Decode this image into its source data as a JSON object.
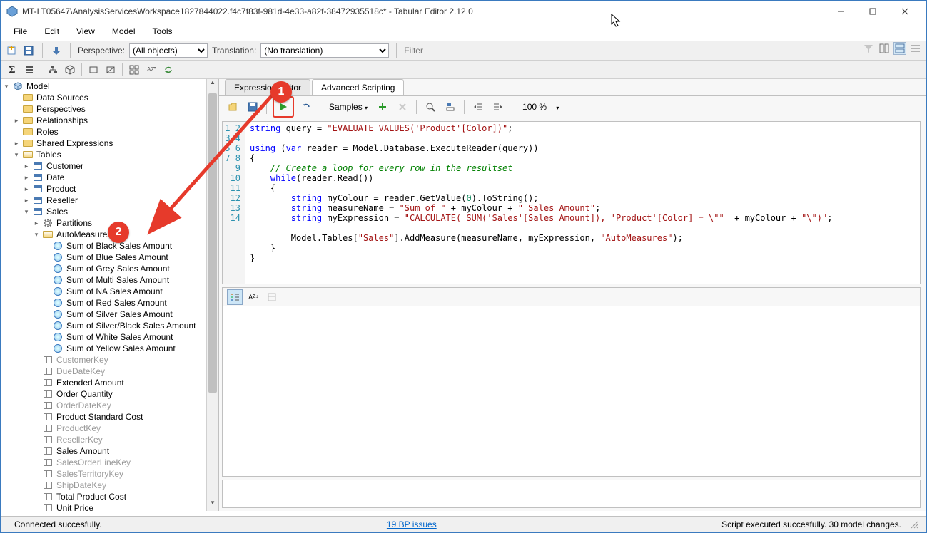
{
  "window": {
    "title": "MT-LT05647\\AnalysisServicesWorkspace1827844022.f4c7f83f-981d-4e33-a82f-38472935518c* - Tabular Editor 2.12.0"
  },
  "menus": [
    "File",
    "Edit",
    "View",
    "Model",
    "Tools"
  ],
  "toolbar": {
    "perspective_label": "Perspective:",
    "perspective_value": "(All objects)",
    "translation_label": "Translation:",
    "translation_value": "(No translation)",
    "filter_placeholder": "Filter"
  },
  "tree": {
    "root": "Model",
    "children": [
      {
        "label": "Data Sources",
        "icon": "folder"
      },
      {
        "label": "Perspectives",
        "icon": "folder"
      },
      {
        "label": "Relationships",
        "icon": "folder",
        "tw": "▸"
      },
      {
        "label": "Roles",
        "icon": "folder"
      },
      {
        "label": "Shared Expressions",
        "icon": "folder",
        "tw": "▸"
      },
      {
        "label": "Tables",
        "icon": "folder-open",
        "tw": "▾"
      }
    ],
    "tables": [
      {
        "label": "Customer",
        "tw": "▸"
      },
      {
        "label": "Date",
        "tw": "▸"
      },
      {
        "label": "Product",
        "tw": "▸"
      },
      {
        "label": "Reseller",
        "tw": "▸"
      },
      {
        "label": "Sales",
        "tw": "▾"
      }
    ],
    "sales_children": [
      {
        "label": "Partitions",
        "icon": "gear",
        "tw": "▸"
      },
      {
        "label": "AutoMeasures",
        "icon": "folder-open",
        "tw": "▾"
      }
    ],
    "auto_measures": [
      "Sum of Black Sales Amount",
      "Sum of Blue Sales Amount",
      "Sum of Grey Sales Amount",
      "Sum of Multi Sales Amount",
      "Sum of NA Sales Amount",
      "Sum of Red Sales Amount",
      "Sum of Silver Sales Amount",
      "Sum of Silver/Black Sales Amount",
      "Sum of White Sales Amount",
      "Sum of Yellow Sales Amount"
    ],
    "columns": [
      {
        "label": "CustomerKey",
        "dim": true
      },
      {
        "label": "DueDateKey",
        "dim": true
      },
      {
        "label": "Extended Amount",
        "dim": false
      },
      {
        "label": "Order Quantity",
        "dim": false
      },
      {
        "label": "OrderDateKey",
        "dim": true
      },
      {
        "label": "Product Standard Cost",
        "dim": false
      },
      {
        "label": "ProductKey",
        "dim": true
      },
      {
        "label": "ResellerKey",
        "dim": true
      },
      {
        "label": "Sales Amount",
        "dim": false
      },
      {
        "label": "SalesOrderLineKey",
        "dim": true
      },
      {
        "label": "SalesTerritoryKey",
        "dim": true
      },
      {
        "label": "ShipDateKey",
        "dim": true
      },
      {
        "label": "Total Product Cost",
        "dim": false
      },
      {
        "label": "Unit Price",
        "dim": false
      }
    ]
  },
  "tabs": {
    "t1": "Expression Editor",
    "t2": "Advanced Scripting"
  },
  "editor_toolbar": {
    "samples": "Samples",
    "zoom": "100 %"
  },
  "code_lines": 14,
  "status": {
    "left": "Connected succesfully.",
    "bp": "19 BP issues",
    "right": "Script executed succesfully. 30 model changes."
  },
  "annotations": {
    "badge1": "1",
    "badge2": "2"
  }
}
